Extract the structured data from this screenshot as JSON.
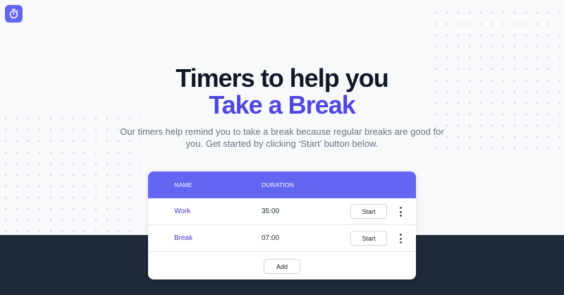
{
  "app": {
    "logo_icon": "stopwatch-icon",
    "accent_color": "#6366f1"
  },
  "hero": {
    "title_line1": "Timers to help you",
    "title_line2": "Take a Break",
    "subtitle": "Our timers help remind you to take a break because regular breaks are good for you. Get started by clicking ‘Start’ button below."
  },
  "table": {
    "headers": {
      "name": "NAME",
      "duration": "DURATION"
    },
    "rows": [
      {
        "name": "Work",
        "duration": "35:00",
        "action": "Start"
      },
      {
        "name": "Break",
        "duration": "07:00",
        "action": "Start"
      }
    ],
    "add_label": "Add"
  }
}
